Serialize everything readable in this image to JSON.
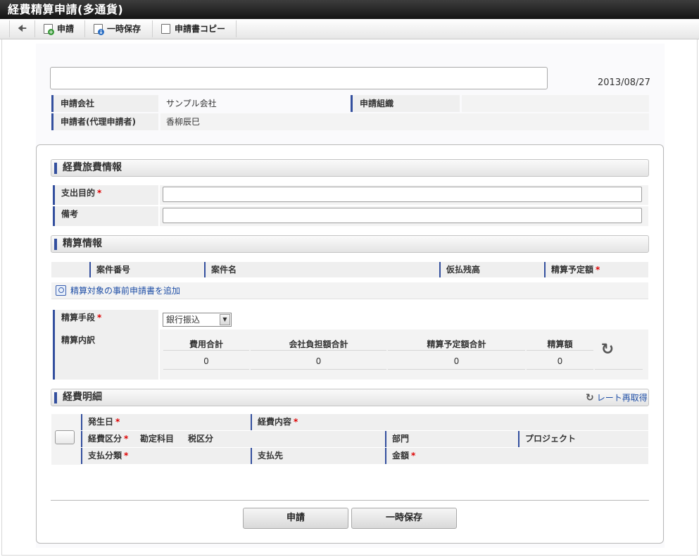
{
  "window": {
    "title": "経費精算申請(多通貨)"
  },
  "toolbar": {
    "back_icon": "arrow-left-icon",
    "apply_label": "申請",
    "save_label": "一時保存",
    "copy_label": "申請書コピー"
  },
  "header": {
    "title_value": "",
    "date": "2013/08/27",
    "company_label": "申請会社",
    "company_value": "サンプル会社",
    "org_label": "申請組織",
    "org_value": "",
    "applicant_label": "申請者(代理申請者)",
    "applicant_value": "香柳辰巳"
  },
  "travel_section": {
    "title": "経費旅費情報",
    "purpose_label": "支出目的",
    "purpose_required": "*",
    "purpose_value": "",
    "note_label": "備考",
    "note_value": ""
  },
  "settlement_section": {
    "title": "精算情報",
    "columns": [
      "案件番号",
      "案件名",
      "仮払残高",
      "精算予定額"
    ],
    "amount_required": "*",
    "add_link": "精算対象の事前申請書を追加",
    "method_label": "精算手段",
    "method_required": "*",
    "method_value": "銀行振込",
    "breakdown_label": "精算内訳",
    "breakdown_headers": [
      "費用合計",
      "会社負担額合計",
      "精算予定額合計",
      "精算額"
    ],
    "breakdown_values": [
      "0",
      "0",
      "0",
      "0"
    ]
  },
  "detail_section": {
    "title": "経費明細",
    "rate_link": "レート再取得",
    "row1": [
      "発生日",
      "経費内容"
    ],
    "row2": [
      "経費区分",
      "勘定科目",
      "税区分",
      "部門",
      "プロジェクト"
    ],
    "row3": [
      "支払分類",
      "支払先",
      "金額"
    ],
    "required": "*"
  },
  "footer": {
    "apply_button": "申請",
    "save_button": "一時保存"
  }
}
